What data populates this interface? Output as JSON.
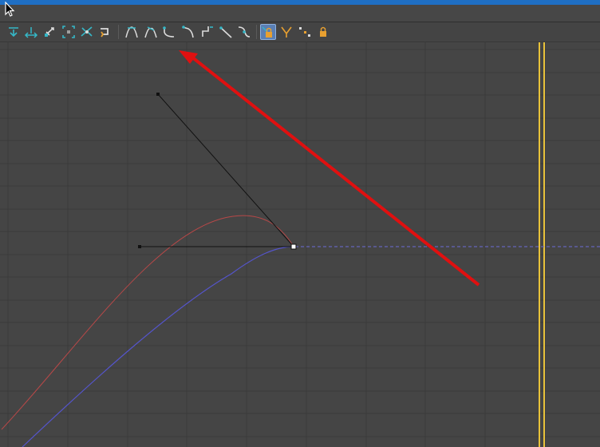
{
  "toolbar": {
    "buttons": [
      {
        "icon": "filter-keys-icon",
        "active": false
      },
      {
        "icon": "move-keys-icon",
        "active": false
      },
      {
        "icon": "slide-keys-icon",
        "active": false
      },
      {
        "icon": "scale-keys-icon",
        "active": false
      },
      {
        "icon": "scale-values-icon",
        "active": false
      },
      {
        "icon": "add-remove-keys-icon",
        "active": false
      },
      {
        "icon": "tangent-auto-icon",
        "active": false
      },
      {
        "icon": "tangent-spline-icon",
        "active": false
      },
      {
        "icon": "tangent-fast-icon",
        "active": false
      },
      {
        "icon": "tangent-slow-icon",
        "active": false
      },
      {
        "icon": "tangent-step-icon",
        "active": false
      },
      {
        "icon": "tangent-linear-icon",
        "active": false
      },
      {
        "icon": "tangent-smooth-icon",
        "active": false
      },
      {
        "icon": "lock-tangents-icon",
        "active": true
      },
      {
        "icon": "break-tangents-icon",
        "active": false
      },
      {
        "icon": "unify-tangents-icon",
        "active": false
      },
      {
        "icon": "lock-keys-icon",
        "active": false
      }
    ]
  },
  "colors": {
    "titlebar_accent": "#1f6fc4",
    "background": "#454545",
    "grid": "#3a3a3a",
    "curve_red": "#b84848",
    "curve_blue": "#5555cc",
    "tangent_handle": "#111111",
    "annotation_arrow": "#e01010",
    "time_slider": "#e8c23a",
    "icon_teal": "#35b8c8",
    "icon_orange": "#e8a030"
  }
}
